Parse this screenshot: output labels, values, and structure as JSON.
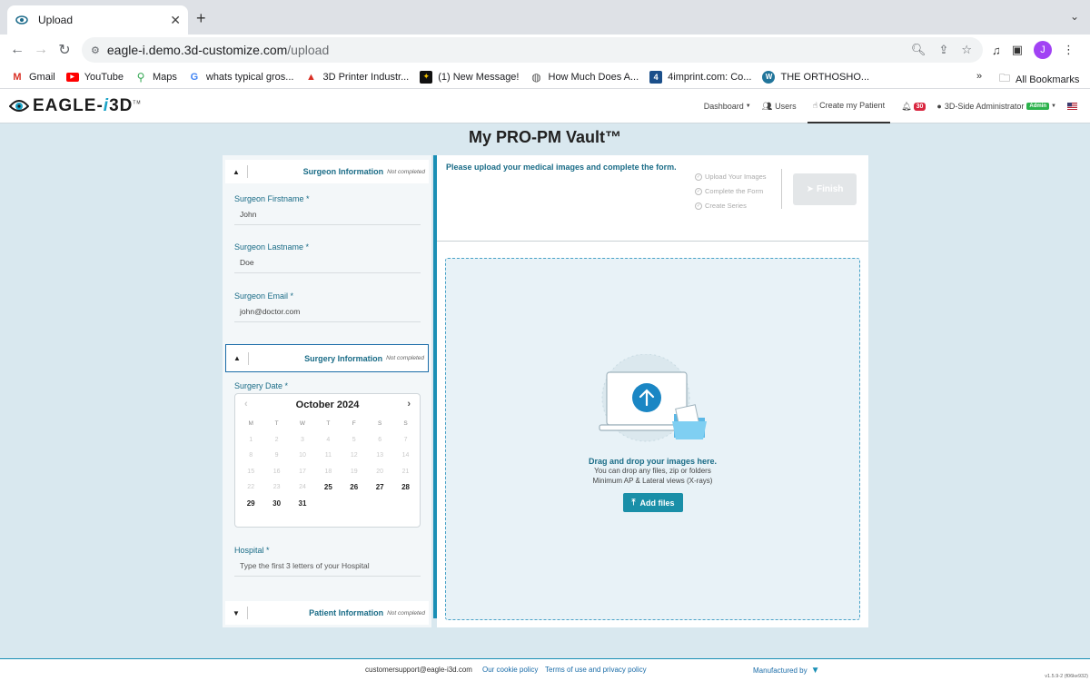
{
  "browser": {
    "tab_title": "Upload",
    "url_host": "eagle-i.demo.3d-customize.com",
    "url_path": "/upload",
    "avatar_letter": "J",
    "bookmarks": [
      "Gmail",
      "YouTube",
      "Maps",
      "whats typical gros...",
      "3D Printer Industr...",
      "(1) New Message!",
      "How Much Does A...",
      "4imprint.com: Co...",
      "THE ORTHOSHO..."
    ],
    "all_bookmarks": "All Bookmarks"
  },
  "app": {
    "logo_prefix": "EAGLE-",
    "logo_i": "i",
    "logo_suffix": "3D",
    "logo_tm": "TM",
    "nav": {
      "dashboard": "Dashboard",
      "users": "Users",
      "create_patient": "Create my Patient",
      "notif_count": "30",
      "admin_name": "3D-Side Administrator",
      "admin_badge": "Admin"
    }
  },
  "page": {
    "title": "My PRO-PM Vault™"
  },
  "form": {
    "surgeon_section": {
      "title": "Surgeon Information",
      "status": "Not completed"
    },
    "firstname": {
      "label": "Surgeon Firstname *",
      "value": "John"
    },
    "lastname": {
      "label": "Surgeon Lastname *",
      "value": "Doe"
    },
    "email": {
      "label": "Surgeon Email *",
      "value": "john@doctor.com"
    },
    "surgery_section": {
      "title": "Surgery Information",
      "status": "Not completed"
    },
    "surgery_date": {
      "label": "Surgery Date *"
    },
    "calendar": {
      "month": "October 2024",
      "weekdays": [
        "M",
        "T",
        "W",
        "T",
        "F",
        "S",
        "S"
      ],
      "disabled_days": [
        "1",
        "2",
        "3",
        "4",
        "5",
        "6",
        "7",
        "8",
        "9",
        "10",
        "11",
        "12",
        "13",
        "14",
        "15",
        "16",
        "17",
        "18",
        "19",
        "20",
        "21",
        "22",
        "23",
        "24"
      ],
      "available_days": [
        "25",
        "26",
        "27",
        "28",
        "29",
        "30",
        "31"
      ]
    },
    "hospital": {
      "label": "Hospital *",
      "placeholder": "Type the first 3 letters of your Hospital"
    },
    "patient_section": {
      "title": "Patient Information",
      "status": "Not completed"
    }
  },
  "upload": {
    "instructions": "Please upload your medical images and complete the form.",
    "steps": [
      "Upload Your Images",
      "Complete the Form",
      "Create Series"
    ],
    "finish_label": "Finish",
    "drop_title": "Drag and drop your images here.",
    "drop_sub1": "You can drop any files, zip or folders",
    "drop_sub2": "Minimum AP & Lateral views (X-rays)",
    "add_files_label": "Add files"
  },
  "footer": {
    "email": "customersupport@eagle-i3d.com",
    "cookie": "Our cookie policy",
    "terms": "Terms of use and privacy policy",
    "manufactured": "Manufactured by",
    "version": "v1.5.9-2 (f06ke932)"
  }
}
